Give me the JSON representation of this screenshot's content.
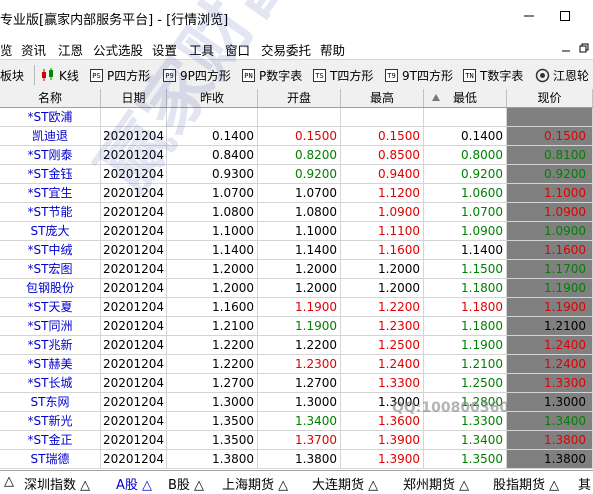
{
  "window": {
    "title": "专业版[赢家内部服务平台] - [行情浏览]"
  },
  "menu": [
    "览",
    "资讯",
    "江恩",
    "公式选股",
    "设置",
    "工具",
    "窗口",
    "交易委托",
    "帮助"
  ],
  "toolbar": [
    {
      "icon": "",
      "label": "板块"
    },
    {
      "icon": "K",
      "label": "K线"
    },
    {
      "icon": "PS",
      "label": "P四方形"
    },
    {
      "icon": "P9",
      "label": "9P四方形"
    },
    {
      "icon": "PN",
      "label": "P数字表"
    },
    {
      "icon": "TS",
      "label": "T四方形"
    },
    {
      "icon": "T9",
      "label": "9T四方形"
    },
    {
      "icon": "TN",
      "label": "T数字表"
    },
    {
      "icon": "",
      "label": "江恩轮"
    }
  ],
  "columns": [
    "名称",
    "日期",
    "昨收",
    "开盘",
    "最高",
    "最低",
    "现价"
  ],
  "rows": [
    {
      "name": "*ST欧浦",
      "date": "",
      "prev": "",
      "open": "",
      "high": "",
      "low": "",
      "price": "",
      "oc": "black",
      "hc": "black",
      "lc": "black",
      "pc": "black"
    },
    {
      "name": "凯迪退",
      "date": "20201204",
      "prev": "0.1400",
      "open": "0.1500",
      "high": "0.1500",
      "low": "0.1400",
      "price": "0.1500",
      "oc": "red",
      "hc": "red",
      "lc": "black",
      "pc": "red"
    },
    {
      "name": "*ST刚泰",
      "date": "20201204",
      "prev": "0.8400",
      "open": "0.8200",
      "high": "0.8500",
      "low": "0.8000",
      "price": "0.8100",
      "oc": "green",
      "hc": "red",
      "lc": "green",
      "pc": "green"
    },
    {
      "name": "*ST金钰",
      "date": "20201204",
      "prev": "0.9300",
      "open": "0.9200",
      "high": "0.9400",
      "low": "0.9200",
      "price": "0.9200",
      "oc": "green",
      "hc": "red",
      "lc": "green",
      "pc": "green"
    },
    {
      "name": "*ST宜生",
      "date": "20201204",
      "prev": "1.0700",
      "open": "1.0700",
      "high": "1.1200",
      "low": "1.0600",
      "price": "1.1000",
      "oc": "black",
      "hc": "red",
      "lc": "green",
      "pc": "red"
    },
    {
      "name": "*ST节能",
      "date": "20201204",
      "prev": "1.0800",
      "open": "1.0800",
      "high": "1.0900",
      "low": "1.0700",
      "price": "1.0900",
      "oc": "black",
      "hc": "red",
      "lc": "green",
      "pc": "red"
    },
    {
      "name": "ST庞大",
      "date": "20201204",
      "prev": "1.1000",
      "open": "1.1000",
      "high": "1.1100",
      "low": "1.0900",
      "price": "1.0900",
      "oc": "black",
      "hc": "red",
      "lc": "green",
      "pc": "green"
    },
    {
      "name": "*ST中绒",
      "date": "20201204",
      "prev": "1.1400",
      "open": "1.1400",
      "high": "1.1600",
      "low": "1.1400",
      "price": "1.1600",
      "oc": "black",
      "hc": "red",
      "lc": "black",
      "pc": "red"
    },
    {
      "name": "*ST宏图",
      "date": "20201204",
      "prev": "1.2000",
      "open": "1.2000",
      "high": "1.2000",
      "low": "1.1500",
      "price": "1.1700",
      "oc": "black",
      "hc": "black",
      "lc": "green",
      "pc": "green"
    },
    {
      "name": "包钢股份",
      "date": "20201204",
      "prev": "1.2000",
      "open": "1.2000",
      "high": "1.2000",
      "low": "1.1800",
      "price": "1.1900",
      "oc": "black",
      "hc": "black",
      "lc": "green",
      "pc": "green"
    },
    {
      "name": "*ST天夏",
      "date": "20201204",
      "prev": "1.1600",
      "open": "1.1900",
      "high": "1.2200",
      "low": "1.1800",
      "price": "1.1900",
      "oc": "red",
      "hc": "red",
      "lc": "red",
      "pc": "red"
    },
    {
      "name": "*ST同洲",
      "date": "20201204",
      "prev": "1.2100",
      "open": "1.1900",
      "high": "1.2300",
      "low": "1.1800",
      "price": "1.2100",
      "oc": "green",
      "hc": "red",
      "lc": "green",
      "pc": "black"
    },
    {
      "name": "*ST兆新",
      "date": "20201204",
      "prev": "1.2200",
      "open": "1.2200",
      "high": "1.2500",
      "low": "1.1900",
      "price": "1.2400",
      "oc": "black",
      "hc": "red",
      "lc": "green",
      "pc": "red"
    },
    {
      "name": "*ST赫美",
      "date": "20201204",
      "prev": "1.2200",
      "open": "1.2300",
      "high": "1.2400",
      "low": "1.2100",
      "price": "1.2400",
      "oc": "red",
      "hc": "red",
      "lc": "green",
      "pc": "red"
    },
    {
      "name": "*ST长城",
      "date": "20201204",
      "prev": "1.2700",
      "open": "1.2700",
      "high": "1.3300",
      "low": "1.2500",
      "price": "1.3300",
      "oc": "black",
      "hc": "red",
      "lc": "green",
      "pc": "red"
    },
    {
      "name": "ST东网",
      "date": "20201204",
      "prev": "1.3000",
      "open": "1.3000",
      "high": "1.3000",
      "low": "1.2800",
      "price": "1.3000",
      "oc": "black",
      "hc": "black",
      "lc": "green",
      "pc": "black"
    },
    {
      "name": "*ST新光",
      "date": "20201204",
      "prev": "1.3500",
      "open": "1.3400",
      "high": "1.3600",
      "low": "1.3300",
      "price": "1.3400",
      "oc": "green",
      "hc": "red",
      "lc": "green",
      "pc": "green"
    },
    {
      "name": "*ST金正",
      "date": "20201204",
      "prev": "1.3500",
      "open": "1.3700",
      "high": "1.3900",
      "low": "1.3400",
      "price": "1.3800",
      "oc": "red",
      "hc": "red",
      "lc": "green",
      "pc": "red"
    },
    {
      "name": "ST瑞德",
      "date": "20201204",
      "prev": "1.3800",
      "open": "1.3800",
      "high": "1.3900",
      "low": "1.3500",
      "price": "1.3800",
      "oc": "black",
      "hc": "red",
      "lc": "green",
      "pc": "black"
    }
  ],
  "tabs": [
    {
      "label": "深圳指数",
      "active": false
    },
    {
      "label": "A股",
      "active": true
    },
    {
      "label": "B股",
      "active": false
    },
    {
      "label": "上海期货",
      "active": false
    },
    {
      "label": "大连期货",
      "active": false
    },
    {
      "label": "郑州期货",
      "active": false
    },
    {
      "label": "股指期货",
      "active": false
    },
    {
      "label": "其",
      "active": false
    }
  ],
  "watermark": {
    "text": "赢家财富网 www.yingjia360.com",
    "qq": "QQ:100800360"
  },
  "colors": {
    "up": "#e00000",
    "down": "#008000",
    "name": "#0000d0",
    "price_bg": "#808080"
  }
}
